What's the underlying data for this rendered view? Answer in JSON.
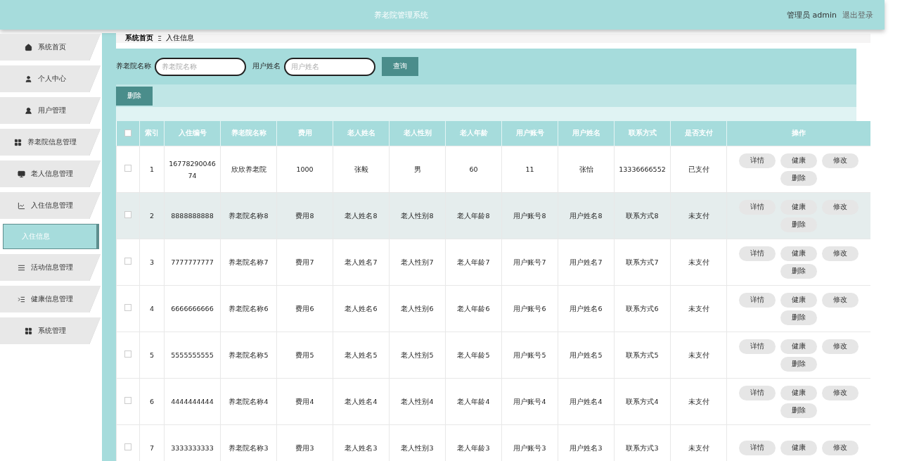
{
  "header": {
    "title": "养老院管理系统",
    "user": "管理员 admin",
    "logout": "退出登录"
  },
  "sidebar": {
    "items": [
      {
        "label": "系统首页",
        "selected": false
      },
      {
        "label": "个人中心",
        "selected": false
      },
      {
        "label": "用户管理",
        "selected": false
      },
      {
        "label": "养老院信息管理",
        "selected": false
      },
      {
        "label": "老人信息管理",
        "selected": false
      },
      {
        "label": "入住信息管理",
        "selected": false,
        "children": [
          {
            "label": "入住信息",
            "selected": true
          }
        ]
      },
      {
        "label": "活动信息管理",
        "selected": false
      },
      {
        "label": "健康信息管理",
        "selected": false
      },
      {
        "label": "系统管理",
        "selected": false
      }
    ]
  },
  "breadcrumb": {
    "home": "系统首页",
    "separator": "Ξ",
    "current": "入住信息"
  },
  "search": {
    "fields": [
      {
        "label": "养老院名称",
        "placeholder": "养老院名称"
      },
      {
        "label": "用户姓名",
        "placeholder": "用户姓名"
      }
    ],
    "button": "查询"
  },
  "delete_button": "删除",
  "table": {
    "columns": [
      "索引",
      "入住编号",
      "养老院名称",
      "费用",
      "老人姓名",
      "老人性别",
      "老人年龄",
      "用户账号",
      "用户姓名",
      "联系方式",
      "是否支付",
      "操作"
    ],
    "header_checked": false,
    "rows": [
      {
        "checked": false,
        "selected": false,
        "cells": [
          "1",
          "16778290046 74",
          "欣欣养老院",
          "1000",
          "张毅",
          "男",
          "60",
          "11",
          "张怡",
          "13336666552",
          "已支付"
        ],
        "actions": [
          "详情",
          "健康",
          "修改",
          "删除"
        ]
      },
      {
        "checked": false,
        "selected": true,
        "cells": [
          "2",
          "8888888888",
          "养老院名称8",
          "费用8",
          "老人姓名8",
          "老人性别8",
          "老人年龄8",
          "用户账号8",
          "用户姓名8",
          "联系方式8",
          "未支付"
        ],
        "actions": [
          "详情",
          "健康",
          "修改",
          "删除"
        ]
      },
      {
        "checked": false,
        "selected": false,
        "cells": [
          "3",
          "7777777777",
          "养老院名称7",
          "费用7",
          "老人姓名7",
          "老人性别7",
          "老人年龄7",
          "用户账号7",
          "用户姓名7",
          "联系方式7",
          "未支付"
        ],
        "actions": [
          "详情",
          "健康",
          "修改",
          "删除"
        ]
      },
      {
        "checked": false,
        "selected": false,
        "cells": [
          "4",
          "6666666666",
          "养老院名称6",
          "费用6",
          "老人姓名6",
          "老人性别6",
          "老人年龄6",
          "用户账号6",
          "用户姓名6",
          "联系方式6",
          "未支付"
        ],
        "actions": [
          "详情",
          "健康",
          "修改",
          "删除"
        ]
      },
      {
        "checked": false,
        "selected": false,
        "cells": [
          "5",
          "5555555555",
          "养老院名称5",
          "费用5",
          "老人姓名5",
          "老人性别5",
          "老人年龄5",
          "用户账号5",
          "用户姓名5",
          "联系方式5",
          "未支付"
        ],
        "actions": [
          "详情",
          "健康",
          "修改",
          "删除"
        ]
      },
      {
        "checked": false,
        "selected": false,
        "cells": [
          "6",
          "4444444444",
          "养老院名称4",
          "费用4",
          "老人姓名4",
          "老人性别4",
          "老人年龄4",
          "用户账号4",
          "用户姓名4",
          "联系方式4",
          "未支付"
        ],
        "actions": [
          "详情",
          "健康",
          "修改",
          "删除"
        ]
      },
      {
        "checked": false,
        "selected": false,
        "cells": [
          "7",
          "3333333333",
          "养老院名称3",
          "费用3",
          "老人姓名3",
          "老人性别3",
          "老人年龄3",
          "用户账号3",
          "用户姓名3",
          "联系方式3",
          "未支付"
        ],
        "actions": [
          "详情",
          "健康",
          "修改"
        ]
      }
    ]
  }
}
